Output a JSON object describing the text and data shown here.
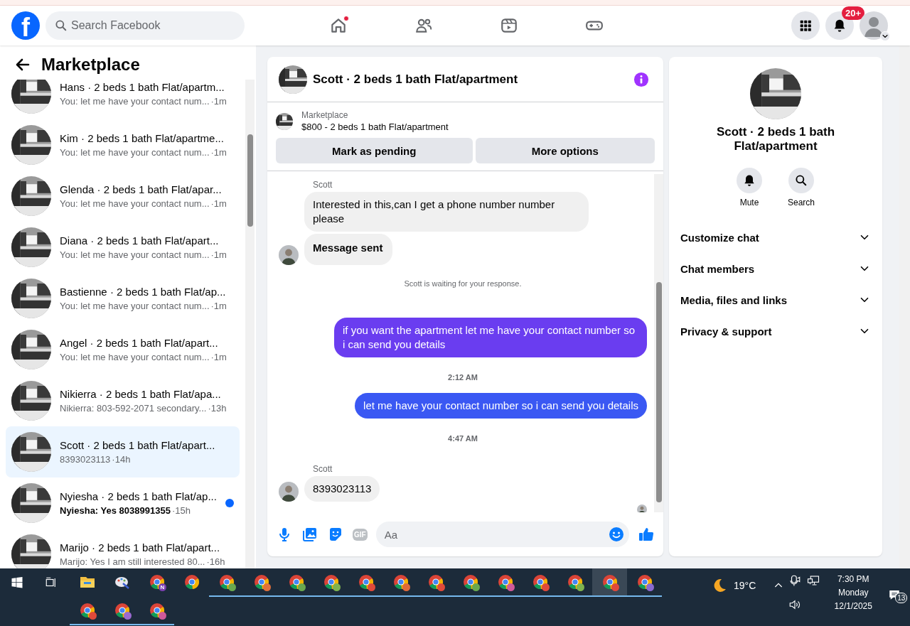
{
  "header": {
    "logo": "f",
    "search": {
      "placeholder": "Search Facebook"
    },
    "nav": [
      {
        "kind": "home",
        "notification_dot": true
      },
      {
        "kind": "friends",
        "notification_dot": false
      },
      {
        "kind": "video",
        "notification_dot": false
      },
      {
        "kind": "gaming",
        "notification_dot": false
      }
    ],
    "notifications_badge": "20+"
  },
  "sidebar": {
    "title": "Marketplace",
    "conversations": [
      {
        "name": "Hans · 2 beds 1 bath Flat/apartm...",
        "preview": "You: let me have your contact num...",
        "time": "·1m",
        "selected": false,
        "unread": false
      },
      {
        "name": "Kim · 2 beds 1 bath Flat/apartme...",
        "preview": "You: let me have your contact num...",
        "time": "·1m",
        "selected": false,
        "unread": false
      },
      {
        "name": "Glenda · 2 beds 1 bath Flat/apar...",
        "preview": "You: let me have your contact num...",
        "time": "·1m",
        "selected": false,
        "unread": false
      },
      {
        "name": "Diana · 2 beds 1 bath Flat/apart...",
        "preview": "You: let me have your contact num...",
        "time": "·1m",
        "selected": false,
        "unread": false
      },
      {
        "name": "Bastienne · 2 beds 1 bath Flat/ap...",
        "preview": "You: let me have your contact num...",
        "time": "·1m",
        "selected": false,
        "unread": false
      },
      {
        "name": "Angel · 2 beds 1 bath Flat/apart...",
        "preview": "You: let me have your contact num...",
        "time": "·1m",
        "selected": false,
        "unread": false
      },
      {
        "name": "Nikierra · 2 beds 1 bath Flat/apa...",
        "preview": "Nikierra: 803-592-2071 secondary...",
        "time": "·13h",
        "selected": false,
        "unread": false
      },
      {
        "name": "Scott · 2 beds 1 bath Flat/apart...",
        "preview": "8393023113",
        "time": "·14h",
        "selected": true,
        "unread": false
      },
      {
        "name": "Nyiesha · 2 beds 1 bath Flat/ap...",
        "preview": "Nyiesha: Yes 8038991355",
        "time": "·15h",
        "selected": false,
        "unread": true
      },
      {
        "name": "Marijo · 2 beds 1 bath Flat/apart...",
        "preview": "Marijo: Yes I am still interested 80...",
        "time": "·16h",
        "selected": false,
        "unread": false
      }
    ]
  },
  "chat": {
    "title": "Scott · 2 beds 1 bath Flat/apartment",
    "listing": {
      "label": "Marketplace",
      "description": "$800 - 2 beds 1 bath Flat/apartment",
      "buttons": [
        "Mark as pending",
        "More options"
      ]
    },
    "messages": [
      {
        "kind": "incoming",
        "sender": "Scott",
        "bubbles": [
          {
            "text": "Interested in this,can I get a phone number number please",
            "bold": false
          },
          {
            "text": "Message sent",
            "bold": true
          }
        ]
      },
      {
        "kind": "notice",
        "text": "Scott is waiting for your response."
      },
      {
        "kind": "outgoing",
        "text": "if you want the apartment let me have your contact number so i can send you details",
        "color": "#6a3df0"
      },
      {
        "kind": "time",
        "text": "2:12 AM"
      },
      {
        "kind": "outgoing",
        "text": "let me have your contact number so i can send you details",
        "color": "#3a58f3"
      },
      {
        "kind": "time",
        "text": "4:47 AM"
      },
      {
        "kind": "incoming",
        "sender": "Scott",
        "bubbles": [
          {
            "text": "8393023113",
            "bold": false
          }
        ]
      }
    ],
    "composer": {
      "placeholder": "Aa",
      "gif_label": "GIF"
    }
  },
  "details": {
    "title": "Scott · 2 beds 1 bath Flat/apartment",
    "actions": [
      {
        "kind": "mute",
        "label": "Mute"
      },
      {
        "kind": "search",
        "label": "Search"
      }
    ],
    "sections": [
      {
        "label": "Customize chat",
        "expanded": false
      },
      {
        "label": "Chat members",
        "expanded": false
      },
      {
        "label": "Media, files and links",
        "expanded": false
      },
      {
        "label": "Privacy & support",
        "expanded": false
      }
    ]
  },
  "taskbar": {
    "apps": [
      {
        "kind": "folder",
        "running": false,
        "selected": false
      },
      {
        "kind": "paint",
        "running": false,
        "selected": false
      },
      {
        "kind": "chrome",
        "badge_text": "N",
        "color": "#7b3fb0",
        "running": false,
        "selected": false
      },
      {
        "kind": "chrome",
        "running": false,
        "selected": false
      },
      {
        "kind": "chrome",
        "color": "#6aa84f",
        "running": true,
        "selected": false
      },
      {
        "kind": "chrome",
        "color": "#e0703a",
        "running": true,
        "selected": false
      },
      {
        "kind": "chrome",
        "color": "#6aa84f",
        "running": true,
        "selected": false
      },
      {
        "kind": "chrome",
        "color": "#7fb34f",
        "running": true,
        "selected": false
      },
      {
        "kind": "chrome",
        "color": "#e04a3a",
        "running": true,
        "selected": false
      },
      {
        "kind": "chrome",
        "color": "#e06a3a",
        "running": true,
        "selected": false
      },
      {
        "kind": "chrome",
        "color": "#e04a3a",
        "running": true,
        "selected": false
      },
      {
        "kind": "chrome",
        "color": "#6aa84f",
        "running": true,
        "selected": false
      },
      {
        "kind": "chrome",
        "color": "#d05a9a",
        "running": true,
        "selected": false
      },
      {
        "kind": "chrome",
        "color": "#e04a3a",
        "running": true,
        "selected": false
      },
      {
        "kind": "chrome",
        "color": "#7fb34f",
        "running": true,
        "selected": false
      },
      {
        "kind": "chrome",
        "color": "#e04a3a",
        "running": true,
        "selected": true
      },
      {
        "kind": "chrome",
        "color": "#8a6ad0",
        "running": true,
        "selected": false
      },
      {
        "kind": "chrome",
        "color": "#e04a3a",
        "running": true,
        "selected": false
      },
      {
        "kind": "chrome",
        "color": "#9a6ad0",
        "running": true,
        "selected": false
      },
      {
        "kind": "chrome",
        "color": "#d05a9a",
        "running": true,
        "selected": false
      }
    ],
    "weather": "19°C",
    "time": "7:30 PM",
    "day": "Monday",
    "date": "12/1/2025",
    "notifications": "13"
  }
}
